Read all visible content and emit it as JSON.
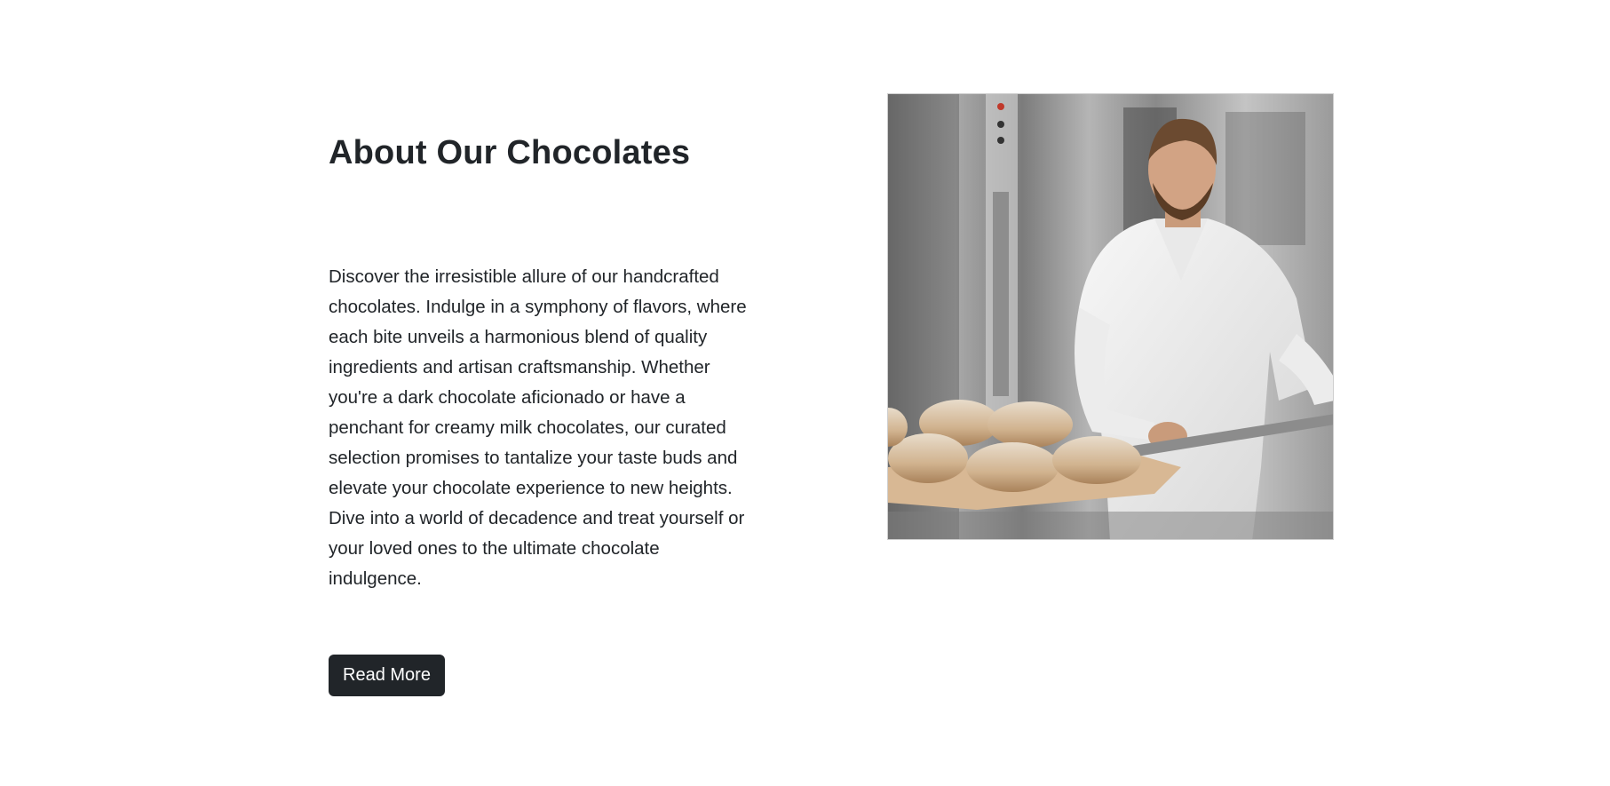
{
  "about": {
    "title": "About Our Chocolates",
    "description": "Discover the irresistible allure of our handcrafted chocolates. Indulge in a symphony of flavors, where each bite unveils a harmonious blend of quality ingredients and artisan craftsmanship. Whether you're a dark chocolate aficionado or have a penchant for creamy milk chocolates, our curated selection promises to tantalize your taste buds and elevate your chocolate experience to new heights. Dive into a world of decadence and treat yourself or your loved ones to the ultimate chocolate indulgence.",
    "button_label": "Read More",
    "image_subject": "baker holding bread loaves on a wooden peel in front of an oven"
  },
  "colors": {
    "text": "#212529",
    "button_bg": "#212529",
    "button_text": "#ffffff",
    "background": "#ffffff"
  }
}
